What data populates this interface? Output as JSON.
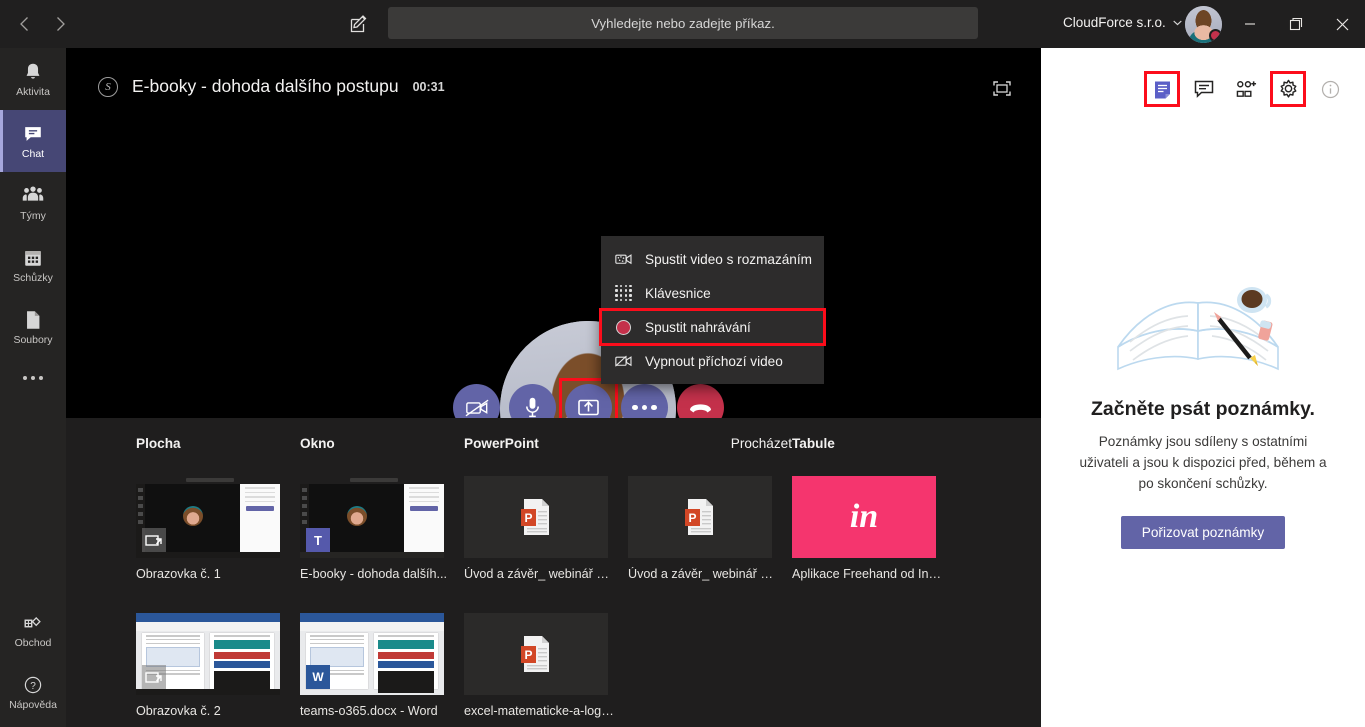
{
  "titlebar": {
    "back_icon": "chevron-left-icon",
    "forward_icon": "chevron-right-icon",
    "compose_icon": "compose-icon",
    "search_placeholder": "Vyhledejte nebo zadejte příkaz.",
    "org_name": "CloudForce s.r.o.",
    "minimize_label": "—",
    "maximize_label": "❐",
    "close_label": "✕"
  },
  "rail": {
    "items": [
      {
        "label": "Aktivita",
        "icon": "bell-icon",
        "active": false
      },
      {
        "label": "Chat",
        "icon": "chat-icon",
        "active": true
      },
      {
        "label": "Týmy",
        "icon": "teams-icon",
        "active": false
      },
      {
        "label": "Schůzky",
        "icon": "calendar-icon",
        "active": false
      },
      {
        "label": "Soubory",
        "icon": "files-icon",
        "active": false
      }
    ],
    "more_icon": "more-dots-icon",
    "bottom": [
      {
        "label": "Obchod",
        "icon": "store-icon"
      },
      {
        "label": "Nápověda",
        "icon": "help-icon"
      }
    ]
  },
  "meeting": {
    "badge_icon": "skype-icon",
    "title": "E-booky - dohoda dalšího postupu",
    "timer": "00:31",
    "expand_icon": "fullscreen-icon",
    "controls": [
      {
        "name": "camera-off-button",
        "icon": "camera-off-icon",
        "highlighted": false
      },
      {
        "name": "microphone-button",
        "icon": "microphone-icon",
        "highlighted": false
      },
      {
        "name": "share-screen-button",
        "icon": "share-screen-icon",
        "highlighted": true
      },
      {
        "name": "more-actions-button",
        "icon": "more-dots-icon",
        "highlighted": false
      },
      {
        "name": "hang-up-button",
        "icon": "hang-up-icon",
        "highlighted": false
      }
    ]
  },
  "context_menu": {
    "items": [
      {
        "label": "Spustit video s rozmazáním",
        "icon": "blur-video-icon",
        "highlighted": false
      },
      {
        "label": "Klávesnice",
        "icon": "dialpad-icon",
        "highlighted": false
      },
      {
        "label": "Spustit nahrávání",
        "icon": "record-icon",
        "highlighted": true
      },
      {
        "label": "Vypnout příchozí video",
        "icon": "incoming-video-off-icon",
        "highlighted": false
      }
    ]
  },
  "share_tray": {
    "columns": [
      {
        "heading": "Plocha",
        "heading_align": "left"
      },
      {
        "heading": "Okno",
        "heading_align": "left"
      },
      {
        "heading": "PowerPoint",
        "heading_align": "left"
      },
      {
        "heading": "Procházet",
        "heading_align": "right"
      },
      {
        "heading": "Tabule",
        "heading_align": "left"
      }
    ],
    "row1": [
      {
        "label": "Obrazovka č. 1",
        "kind": "screen",
        "badge": "screen-share-icon"
      },
      {
        "label": "E-booky - dohoda dalšíh...",
        "kind": "teams-window",
        "badge": "teams-icon"
      },
      {
        "label": "Úvod a závěr_ webinář Ex...",
        "kind": "powerpoint",
        "badge": ""
      },
      {
        "label": "Úvod a závěr_ webinář Ex...",
        "kind": "powerpoint",
        "badge": ""
      },
      {
        "label": "Aplikace Freehand od InVis",
        "kind": "whiteboard",
        "badge": "",
        "logo": "in",
        "color": "#f5356e"
      }
    ],
    "row2": [
      {
        "label": "Obrazovka č. 2",
        "kind": "word-screen",
        "badge": "screen-share-icon"
      },
      {
        "label": "teams-o365.docx - Word",
        "kind": "word-window",
        "badge": "word-icon",
        "badge_text": "W"
      },
      {
        "label": "excel-matematicke-a-logi...",
        "kind": "powerpoint",
        "badge": ""
      }
    ]
  },
  "right_panel": {
    "icons": [
      {
        "name": "meeting-notes-icon",
        "highlighted": true
      },
      {
        "name": "chat-icon",
        "highlighted": false
      },
      {
        "name": "add-people-icon",
        "highlighted": false
      },
      {
        "name": "settings-gear-icon",
        "highlighted": true
      },
      {
        "name": "info-icon",
        "highlighted": false
      }
    ],
    "illustration": "notebook-pencil-coffee-illustration",
    "title": "Začněte psát poznámky.",
    "subtitle": "Poznámky jsou sdíleny s ostatními uživateli a jsou k dispozici před, během a po skončení schůzky.",
    "button_label": "Pořizovat poznámky"
  },
  "colors": {
    "accent_purple": "#6264a7",
    "rail_active": "#464775",
    "highlight_red": "#fc0d1b",
    "hangup_red": "#c4314b",
    "whiteboard_pink": "#f5356e"
  }
}
